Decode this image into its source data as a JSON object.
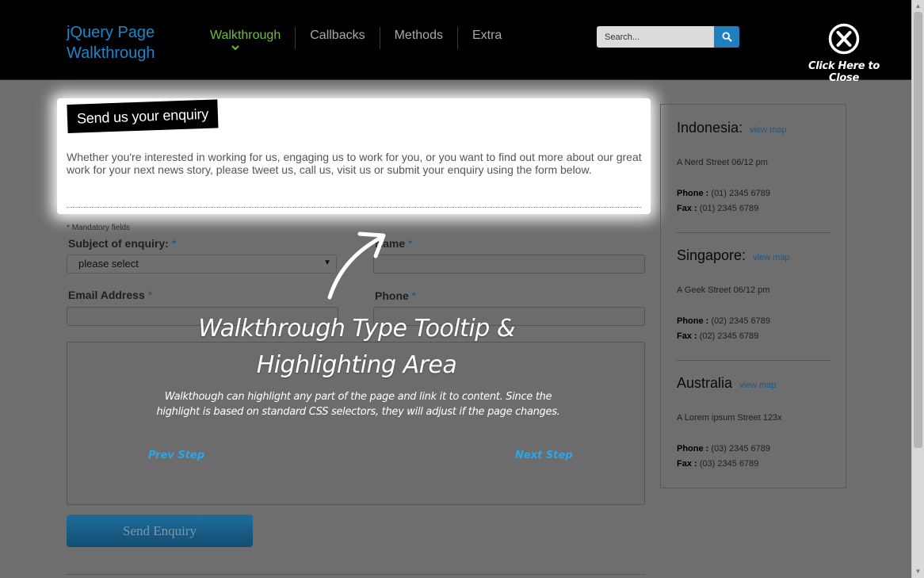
{
  "header": {
    "logo_line1": "jQuery Page",
    "logo_line2": "Walkthrough",
    "nav": [
      {
        "label": "Walkthrough",
        "active": true
      },
      {
        "label": "Callbacks"
      },
      {
        "label": "Methods"
      },
      {
        "label": "Extra"
      }
    ],
    "search_placeholder": "Search...",
    "close_label": "Click Here to Close"
  },
  "highlight": {
    "title": "Send us your enquiry",
    "intro": "Whether you're interested in working for us, engaging us to work for you, or you want to find out more about our great work for your next news story, please tweet us, call us, visit us or submit your enquiry using the form below."
  },
  "form": {
    "mandatory_star": "*",
    "mandatory_note": "Mandatory fields",
    "required_mark": "*",
    "subject_label": "Subject of enquiry:",
    "subject_selected": "please select",
    "name_label": "Name",
    "email_label": "Email Address",
    "phone_label": "Phone",
    "send_button": "Send Enquiry"
  },
  "offices": [
    {
      "name": "Indonesia:",
      "map_link": "view map",
      "address": "A Nerd Street 06/12 pm",
      "phone_label": "Phone :",
      "phone": "(01) 2345 6789",
      "fax_label": "Fax :",
      "fax": "(01) 2345 6789"
    },
    {
      "name": "Singapore:",
      "map_link": "view map",
      "address": "A Geek Street 06/12 pm",
      "phone_label": "Phone :",
      "phone": "(02) 2345 6789",
      "fax_label": "Fax :",
      "fax": "(02) 2345 6789"
    },
    {
      "name": "Australia",
      "map_link": "view map",
      "address": "A Lorem ipsum Street 123x",
      "phone_label": "Phone :",
      "phone": "(03) 2345 6789",
      "fax_label": "Fax :",
      "fax": "(03) 2345 6789"
    }
  ],
  "tooltip": {
    "title_line1": "Walkthrough Type Tooltip &",
    "title_line2": "Highlighting Area",
    "body": "Walkthough can highlight any part of the page and link it to content. Since the highlight is based on standard CSS selectors, they will adjust if the page changes.",
    "prev": "Prev Step",
    "next": "Next Step"
  },
  "colors": {
    "accent_blue": "#1f85c7",
    "nav_active": "#6fbd3a",
    "tip_link": "#2aa6ec",
    "overlay": "#6e6e6e"
  },
  "icons": {
    "search": "search-icon",
    "close": "close-icon",
    "chevron": "chevron-down-icon",
    "arrow": "curved-arrow-icon"
  }
}
